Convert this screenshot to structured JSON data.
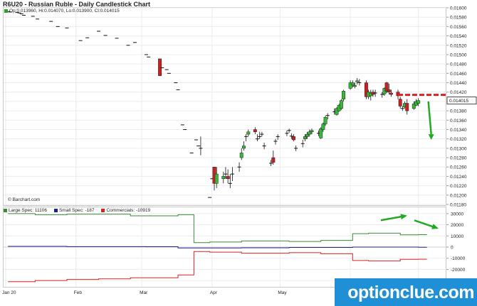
{
  "header": {
    "title": "R6U20 - Russian Ruble - Daily Candlestick Chart",
    "ohlc": "Op:0.013960, Hi:0.014070, Lo:0.013900, Cl:0.014015",
    "credit": "© Barchart.com"
  },
  "colors": {
    "up": "#33bb33",
    "down": "#cc1f1f",
    "large_spec": "#3a8a3a",
    "small_spec": "#1e1e8c",
    "commercials": "#d42424",
    "annotation_green": "#22aa22",
    "annotation_red": "#dd1f1f",
    "watermark_bg": "#1f8fd6"
  },
  "watermark": "optionclue.com",
  "chart_data": [
    {
      "type": "candlestick",
      "title": "R6U20 - Russian Ruble - Daily Candlestick Chart",
      "ylim": [
        0.0118,
        0.016
      ],
      "y_ticks": [
        "0.01600",
        "0.01580",
        "0.01560",
        "0.01540",
        "0.01520",
        "0.01500",
        "0.01480",
        "0.01460",
        "0.01440",
        "0.01420",
        "0.01400",
        "0.01380",
        "0.01360",
        "0.01340",
        "0.01320",
        "0.01300",
        "0.01280",
        "0.01260",
        "0.01240",
        "0.01220",
        "0.01200",
        "0.01180"
      ],
      "last_price_label": "0.014015",
      "x_labels": [
        "Jan 20",
        "Feb",
        "Mar",
        "Apr",
        "May",
        "Jun"
      ],
      "annotations": {
        "resistance_level": 0.01414,
        "arrow": "down"
      },
      "candles": [
        {
          "d": "01-02",
          "o": 0.01592,
          "h": 0.01592,
          "l": 0.01592,
          "c": 0.01592
        },
        {
          "d": "01-03",
          "o": 0.01591,
          "h": 0.01591,
          "l": 0.01591,
          "c": 0.01591
        },
        {
          "d": "01-06",
          "o": 0.0159,
          "h": 0.0159,
          "l": 0.0159,
          "c": 0.0159
        },
        {
          "d": "01-07",
          "o": 0.01589,
          "h": 0.01589,
          "l": 0.01589,
          "c": 0.01589
        },
        {
          "d": "01-08",
          "o": 0.01587,
          "h": 0.01587,
          "l": 0.01587,
          "c": 0.01587
        },
        {
          "d": "01-09",
          "o": 0.01584,
          "h": 0.01584,
          "l": 0.01584,
          "c": 0.01584
        },
        {
          "d": "01-13",
          "o": 0.01582,
          "h": 0.01582,
          "l": 0.01582,
          "c": 0.01582
        },
        {
          "d": "01-15",
          "o": 0.01576,
          "h": 0.01576,
          "l": 0.01576,
          "c": 0.01576
        },
        {
          "d": "01-21",
          "o": 0.01571,
          "h": 0.01571,
          "l": 0.01571,
          "c": 0.01571
        },
        {
          "d": "01-24",
          "o": 0.0156,
          "h": 0.0156,
          "l": 0.0156,
          "c": 0.0156
        },
        {
          "d": "01-28",
          "o": 0.01557,
          "h": 0.01557,
          "l": 0.01557,
          "c": 0.01557
        },
        {
          "d": "02-03",
          "o": 0.0153,
          "h": 0.0153,
          "l": 0.0153,
          "c": 0.0153
        },
        {
          "d": "02-06",
          "o": 0.01536,
          "h": 0.01536,
          "l": 0.01536,
          "c": 0.01536
        },
        {
          "d": "02-11",
          "o": 0.0155,
          "h": 0.0155,
          "l": 0.0155,
          "c": 0.0155
        },
        {
          "d": "02-14",
          "o": 0.01541,
          "h": 0.01541,
          "l": 0.01541,
          "c": 0.01541
        },
        {
          "d": "02-19",
          "o": 0.01535,
          "h": 0.01535,
          "l": 0.01535,
          "c": 0.01535
        },
        {
          "d": "02-24",
          "o": 0.0152,
          "h": 0.0152,
          "l": 0.0152,
          "c": 0.0152
        },
        {
          "d": "02-27",
          "o": 0.01526,
          "h": 0.01526,
          "l": 0.01526,
          "c": 0.01526
        },
        {
          "d": "03-03",
          "o": 0.015,
          "h": 0.015,
          "l": 0.015,
          "c": 0.015
        },
        {
          "d": "03-04",
          "o": 0.01495,
          "h": 0.01495,
          "l": 0.01495,
          "c": 0.01495
        },
        {
          "d": "03-09",
          "o": 0.01491,
          "h": 0.01491,
          "l": 0.01455,
          "c": 0.01455
        },
        {
          "d": "03-10",
          "o": 0.01472,
          "h": 0.01472,
          "l": 0.01472,
          "c": 0.01472
        },
        {
          "d": "03-12",
          "o": 0.01468,
          "h": 0.01468,
          "l": 0.01468,
          "c": 0.01468
        },
        {
          "d": "03-13",
          "o": 0.0146,
          "h": 0.0146,
          "l": 0.0146,
          "c": 0.0146
        },
        {
          "d": "03-16",
          "o": 0.0144,
          "h": 0.0144,
          "l": 0.0144,
          "c": 0.0144
        },
        {
          "d": "03-17",
          "o": 0.01425,
          "h": 0.01425,
          "l": 0.01425,
          "c": 0.01425
        },
        {
          "d": "03-19",
          "o": 0.0135,
          "h": 0.0135,
          "l": 0.0135,
          "c": 0.0135
        },
        {
          "d": "03-20",
          "o": 0.0134,
          "h": 0.0134,
          "l": 0.0134,
          "c": 0.0134
        },
        {
          "d": "03-23",
          "o": 0.0129,
          "h": 0.0129,
          "l": 0.0129,
          "c": 0.0129
        },
        {
          "d": "03-25",
          "o": 0.01318,
          "h": 0.01318,
          "l": 0.01318,
          "c": 0.01318
        },
        {
          "d": "03-26",
          "o": 0.01305,
          "h": 0.01305,
          "l": 0.01305,
          "c": 0.01305
        },
        {
          "d": "03-27",
          "o": 0.013,
          "h": 0.01325,
          "l": 0.01285,
          "c": 0.013
        },
        {
          "d": "03-31",
          "o": 0.01195,
          "h": 0.01195,
          "l": 0.01195,
          "c": 0.01195
        },
        {
          "d": "04-01",
          "o": 0.01235,
          "h": 0.01235,
          "l": 0.01235,
          "c": 0.01235
        },
        {
          "d": "04-02",
          "o": 0.0126,
          "h": 0.0126,
          "l": 0.0121,
          "c": 0.01225
        },
        {
          "d": "04-03",
          "o": 0.01225,
          "h": 0.0126,
          "l": 0.01215,
          "c": 0.01245
        },
        {
          "d": "04-06",
          "o": 0.01235,
          "h": 0.0125,
          "l": 0.01225,
          "c": 0.0124
        },
        {
          "d": "04-07",
          "o": 0.01245,
          "h": 0.0126,
          "l": 0.01235,
          "c": 0.01245
        },
        {
          "d": "04-08",
          "o": 0.0124,
          "h": 0.01255,
          "l": 0.01225,
          "c": 0.01235
        },
        {
          "d": "04-09",
          "o": 0.01225,
          "h": 0.01245,
          "l": 0.01215,
          "c": 0.01225
        },
        {
          "d": "04-10",
          "o": 0.01245,
          "h": 0.0126,
          "l": 0.0123,
          "c": 0.01245
        },
        {
          "d": "04-13",
          "o": 0.0126,
          "h": 0.0127,
          "l": 0.0125,
          "c": 0.0126
        },
        {
          "d": "04-14",
          "o": 0.0128,
          "h": 0.013,
          "l": 0.01275,
          "c": 0.0129
        },
        {
          "d": "04-15",
          "o": 0.013,
          "h": 0.01315,
          "l": 0.01295,
          "c": 0.01305
        },
        {
          "d": "04-16",
          "o": 0.01325,
          "h": 0.0133,
          "l": 0.01315,
          "c": 0.01325
        },
        {
          "d": "04-17",
          "o": 0.0133,
          "h": 0.0134,
          "l": 0.01325,
          "c": 0.01335
        },
        {
          "d": "04-20",
          "o": 0.0134,
          "h": 0.01345,
          "l": 0.0133,
          "c": 0.01335
        },
        {
          "d": "04-21",
          "o": 0.0132,
          "h": 0.0133,
          "l": 0.01315,
          "c": 0.0132
        },
        {
          "d": "04-22",
          "o": 0.01325,
          "h": 0.01335,
          "l": 0.0132,
          "c": 0.01325
        },
        {
          "d": "04-23",
          "o": 0.0133,
          "h": 0.01335,
          "l": 0.01325,
          "c": 0.0133
        },
        {
          "d": "04-24",
          "o": 0.01305,
          "h": 0.01312,
          "l": 0.01298,
          "c": 0.01305
        },
        {
          "d": "04-27",
          "o": 0.01268,
          "h": 0.01275,
          "l": 0.01262,
          "c": 0.01268
        },
        {
          "d": "04-28",
          "o": 0.0128,
          "h": 0.01295,
          "l": 0.01265,
          "c": 0.0127
        },
        {
          "d": "04-29",
          "o": 0.01315,
          "h": 0.0132,
          "l": 0.01308,
          "c": 0.01315
        },
        {
          "d": "04-30",
          "o": 0.01325,
          "h": 0.0133,
          "l": 0.01318,
          "c": 0.01325
        },
        {
          "d": "05-04",
          "o": 0.01332,
          "h": 0.01338,
          "l": 0.01326,
          "c": 0.01332
        },
        {
          "d": "05-05",
          "o": 0.01338,
          "h": 0.01342,
          "l": 0.01333,
          "c": 0.01338
        },
        {
          "d": "05-06",
          "o": 0.01326,
          "h": 0.01332,
          "l": 0.0132,
          "c": 0.01326
        },
        {
          "d": "05-07",
          "o": 0.01325,
          "h": 0.0133,
          "l": 0.01315,
          "c": 0.01318
        },
        {
          "d": "05-08",
          "o": 0.013,
          "h": 0.01306,
          "l": 0.01294,
          "c": 0.013
        },
        {
          "d": "05-11",
          "o": 0.0131,
          "h": 0.01318,
          "l": 0.01302,
          "c": 0.0131
        },
        {
          "d": "05-12",
          "o": 0.0132,
          "h": 0.0133,
          "l": 0.01315,
          "c": 0.01325
        },
        {
          "d": "05-13",
          "o": 0.01325,
          "h": 0.01335,
          "l": 0.0132,
          "c": 0.0133
        },
        {
          "d": "05-14",
          "o": 0.0133,
          "h": 0.0134,
          "l": 0.01325,
          "c": 0.01335
        },
        {
          "d": "05-15",
          "o": 0.01335,
          "h": 0.01342,
          "l": 0.0133,
          "c": 0.01338
        },
        {
          "d": "05-18",
          "o": 0.01332,
          "h": 0.01338,
          "l": 0.01326,
          "c": 0.01332
        },
        {
          "d": "05-19",
          "o": 0.01322,
          "h": 0.01345,
          "l": 0.0132,
          "c": 0.01342
        },
        {
          "d": "05-20",
          "o": 0.0134,
          "h": 0.01355,
          "l": 0.01335,
          "c": 0.01352
        },
        {
          "d": "05-21",
          "o": 0.01352,
          "h": 0.0137,
          "l": 0.01348,
          "c": 0.01366
        },
        {
          "d": "05-22",
          "o": 0.0137,
          "h": 0.01375,
          "l": 0.01362,
          "c": 0.0137
        },
        {
          "d": "05-25",
          "o": 0.01378,
          "h": 0.01385,
          "l": 0.01372,
          "c": 0.01378
        },
        {
          "d": "05-26",
          "o": 0.01372,
          "h": 0.01388,
          "l": 0.0137,
          "c": 0.01385
        },
        {
          "d": "05-27",
          "o": 0.0138,
          "h": 0.01395,
          "l": 0.01378,
          "c": 0.01392
        },
        {
          "d": "05-28",
          "o": 0.01385,
          "h": 0.01405,
          "l": 0.01382,
          "c": 0.01402
        },
        {
          "d": "05-29",
          "o": 0.01405,
          "h": 0.01425,
          "l": 0.014,
          "c": 0.01422
        },
        {
          "d": "06-01",
          "o": 0.01428,
          "h": 0.01445,
          "l": 0.01425,
          "c": 0.0144
        },
        {
          "d": "06-02",
          "o": 0.01435,
          "h": 0.01445,
          "l": 0.0143,
          "c": 0.0144
        },
        {
          "d": "06-03",
          "o": 0.01432,
          "h": 0.0144,
          "l": 0.01428,
          "c": 0.01434
        },
        {
          "d": "06-04",
          "o": 0.01442,
          "h": 0.0145,
          "l": 0.01436,
          "c": 0.01444
        },
        {
          "d": "06-05",
          "o": 0.0144,
          "h": 0.01448,
          "l": 0.01434,
          "c": 0.0144
        },
        {
          "d": "06-08",
          "o": 0.0144,
          "h": 0.01445,
          "l": 0.01405,
          "c": 0.0141
        },
        {
          "d": "06-09",
          "o": 0.0141,
          "h": 0.01425,
          "l": 0.01405,
          "c": 0.0142
        },
        {
          "d": "06-10",
          "o": 0.01412,
          "h": 0.01425,
          "l": 0.01402,
          "c": 0.01418
        },
        {
          "d": "06-11",
          "o": 0.0142,
          "h": 0.01425,
          "l": 0.0141,
          "c": 0.01415
        },
        {
          "d": "06-12",
          "o": 0.01418,
          "h": 0.01425,
          "l": 0.0141,
          "c": 0.01418
        },
        {
          "d": "06-15",
          "o": 0.01415,
          "h": 0.0142,
          "l": 0.01408,
          "c": 0.01415
        },
        {
          "d": "06-16",
          "o": 0.01416,
          "h": 0.0143,
          "l": 0.01412,
          "c": 0.01428
        },
        {
          "d": "06-17",
          "o": 0.0144,
          "h": 0.01442,
          "l": 0.01418,
          "c": 0.01422
        },
        {
          "d": "06-18",
          "o": 0.01425,
          "h": 0.01438,
          "l": 0.01415,
          "c": 0.0142
        },
        {
          "d": "06-19",
          "o": 0.01418,
          "h": 0.01425,
          "l": 0.0141,
          "c": 0.01415
        },
        {
          "d": "06-22",
          "o": 0.0142,
          "h": 0.01425,
          "l": 0.01405,
          "c": 0.01412
        },
        {
          "d": "06-23",
          "o": 0.01405,
          "h": 0.0141,
          "l": 0.01385,
          "c": 0.0139
        },
        {
          "d": "06-24",
          "o": 0.01385,
          "h": 0.0139,
          "l": 0.0138,
          "c": 0.01385
        },
        {
          "d": "06-25",
          "o": 0.01388,
          "h": 0.014,
          "l": 0.01385,
          "c": 0.01396
        },
        {
          "d": "06-26",
          "o": 0.01396,
          "h": 0.01405,
          "l": 0.01372,
          "c": 0.0138
        },
        {
          "d": "06-29",
          "o": 0.01385,
          "h": 0.014,
          "l": 0.01382,
          "c": 0.01395
        },
        {
          "d": "06-30",
          "o": 0.01392,
          "h": 0.01405,
          "l": 0.0139,
          "c": 0.014
        },
        {
          "d": "07-01",
          "o": 0.01396,
          "h": 0.01407,
          "l": 0.0139,
          "c": 0.01402
        }
      ]
    },
    {
      "type": "line",
      "title": "",
      "ylim": [
        -35000,
        35000
      ],
      "y_ticks": [
        "30000",
        "20000",
        "10000",
        "0",
        "-10000",
        "-20000",
        "-30000"
      ],
      "x_labels": [
        "Jan 20",
        "Feb",
        "Mar",
        "Apr",
        "May",
        "Jun"
      ],
      "step": true,
      "series": [
        {
          "name": "Large Spec: 11106",
          "color": "#3a8a3a",
          "x": [
            "01-02",
            "01-14",
            "01-28",
            "02-25",
            "03-17",
            "03-24",
            "03-31",
            "04-14",
            "05-05",
            "05-19",
            "06-02",
            "06-09",
            "06-23",
            "07-01"
          ],
          "values": [
            30000,
            29000,
            29500,
            28000,
            29000,
            4000,
            4500,
            5500,
            5000,
            6000,
            12000,
            12500,
            11000,
            11106
          ]
        },
        {
          "name": "Small Spec: -187",
          "color": "#1e1e8c",
          "x": [
            "01-02",
            "01-28",
            "03-03",
            "03-17",
            "04-14",
            "05-05",
            "06-02",
            "07-01"
          ],
          "values": [
            600,
            400,
            300,
            -800,
            -600,
            -300,
            0,
            -187
          ]
        },
        {
          "name": "Commercials: -10919",
          "color": "#d42424",
          "x": [
            "01-02",
            "01-14",
            "01-28",
            "02-11",
            "02-25",
            "03-17",
            "03-24",
            "03-31",
            "04-14",
            "05-05",
            "05-19",
            "06-02",
            "06-09",
            "06-23",
            "07-01"
          ],
          "values": [
            -31000,
            -30000,
            -29000,
            -28500,
            -27500,
            -25000,
            -4000,
            -4500,
            -5500,
            -5000,
            -6000,
            -12000,
            -12500,
            -11000,
            -10919
          ]
        }
      ]
    }
  ]
}
